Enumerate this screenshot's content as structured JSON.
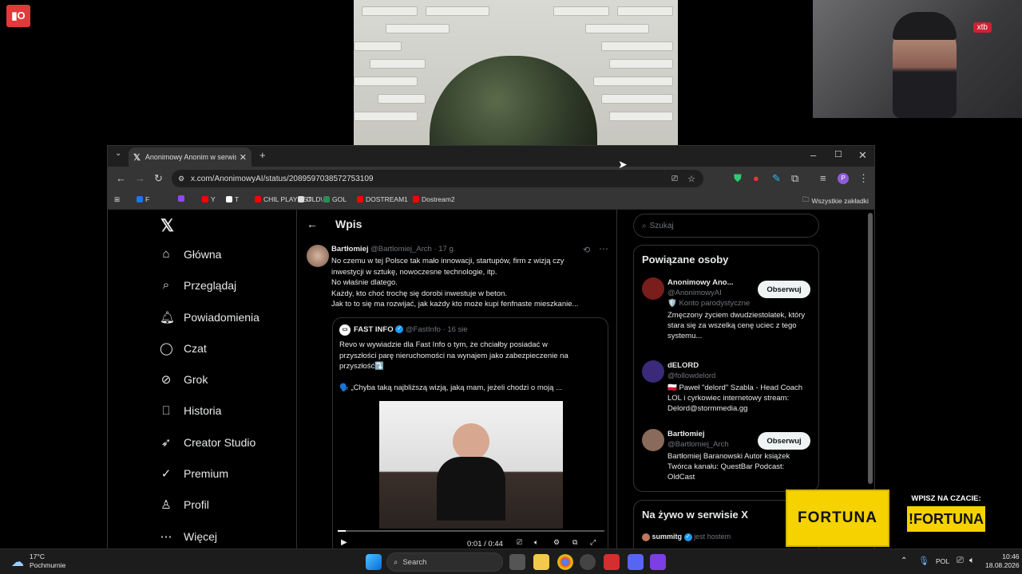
{
  "overlay": {
    "logo_text": "▮O",
    "webcam_badge": "xtb"
  },
  "browser": {
    "tab_title": "Anonimowy Anonim w serwisie",
    "url": "x.com/AnonimowyAI/status/2089597038572753109",
    "bookmarks": [
      {
        "label": "F",
        "color": "#1877f2"
      },
      {
        "label": "",
        "color": "#9146ff"
      },
      {
        "label": "Y",
        "color": "#ff0000"
      },
      {
        "label": "T",
        "color": "#ffffff"
      },
      {
        "label": "CHIL PLAYLIST",
        "color": "#ff0000"
      },
      {
        "label": "OLD\\",
        "color": "#dddddd"
      },
      {
        "label": "GOL",
        "color": "#2e8b57"
      },
      {
        "label": "DOSTREAM1",
        "color": "#ff0000"
      },
      {
        "label": "Dostream2",
        "color": "#ff0000"
      }
    ],
    "all_bookmarks": "Wszystkie zakładki"
  },
  "nav": [
    {
      "label": "Główna",
      "icon": "home-icon",
      "glyph": "⌂"
    },
    {
      "label": "Przeglądaj",
      "icon": "search-icon",
      "glyph": "⌕"
    },
    {
      "label": "Powiadomienia",
      "icon": "bell-icon",
      "glyph": "🔔︎"
    },
    {
      "label": "Czat",
      "icon": "chat-icon",
      "glyph": "◯"
    },
    {
      "label": "Grok",
      "icon": "grok-icon",
      "glyph": "⊘"
    },
    {
      "label": "Historia",
      "icon": "bookmark-icon",
      "glyph": "⎕"
    },
    {
      "label": "Creator Studio",
      "icon": "rocket-icon",
      "glyph": "➶"
    },
    {
      "label": "Premium",
      "icon": "premium-icon",
      "glyph": "✓"
    },
    {
      "label": "Profil",
      "icon": "profile-icon",
      "glyph": "♙"
    },
    {
      "label": "Więcej",
      "icon": "more-icon",
      "glyph": "⋯"
    }
  ],
  "post": {
    "header": "Wpis",
    "author": "Bartłomiej",
    "handle": "@Bartlomiej_Arch",
    "time": "· 17 g.",
    "lines": [
      "No czemu w tej Polsce tak mało innowacji, startupów, firm z wizją czy",
      "inwestycji w sztukę, nowoczesne technologie, itp.",
      "No właśnie dlatego.",
      "Każdy, kto choć trochę się dorobi inwestuje w beton.",
      "Jak to to się ma rozwijać, jak każdy kto może kupi fenfnaste mieszkanie..."
    ],
    "quote": {
      "author": "FAST INFO",
      "handle": "@FastInfo",
      "time": "· 16 sie",
      "lines": [
        "Revo w wywiadzie dla Fast Info o tym, że chciałby posiadać w",
        "przyszłości parę nieruchomości na wynajem jako zabezpieczenie na",
        "przyszłość⤵️"
      ],
      "quote_line": "🗣️ „Chyba taką najbliższą wizją, jaką mam, jeżeli chodzi o moją ...",
      "video_time": "0:01 / 0:44"
    }
  },
  "sidebar": {
    "search_placeholder": "Szukaj",
    "related_title": "Powiązane osoby",
    "follow_label": "Obserwuj",
    "people": [
      {
        "name": "Anonimowy Ano...",
        "handle": "@AnonimowyAI",
        "note": "🛡️ Konto parodystyczne",
        "bio": "Zmęczony życiem dwudziestolatek, który stara się za wszelką cenę uciec z tego systemu...",
        "follow": true,
        "color": "#7a1d1d"
      },
      {
        "name": "dELORD",
        "handle": "@followdelord",
        "note": "",
        "bio": "🇵🇱 Paweł \"delord\" Szabla - Head Coach LOL i cyrkowiec internetowy stream: Delord@stormmedia.gg",
        "follow": false,
        "color": "#3b2a7a"
      },
      {
        "name": "Bartłomiej",
        "handle": "@Bartlomiej_Arch",
        "note": "",
        "bio": "Bartłomiej Baranowski Autor książek Twórca kanału: QuestBar Podcast: OldCast",
        "follow": true,
        "color": "#8a6a5a"
      }
    ],
    "live_title": "Na żywo w serwisie X",
    "live_user": "summitg",
    "live_note": "jest hostem"
  },
  "fortuna": {
    "logo": "FORTUNA",
    "promo": "WPISZ NA CZACIE:",
    "code": "!FORTUNA"
  },
  "taskbar": {
    "weather_temp": "17°C",
    "weather_desc": "Pochmurnie",
    "search": "Search",
    "lang": "POL",
    "time": "10:46",
    "date": "18.08.2026"
  }
}
